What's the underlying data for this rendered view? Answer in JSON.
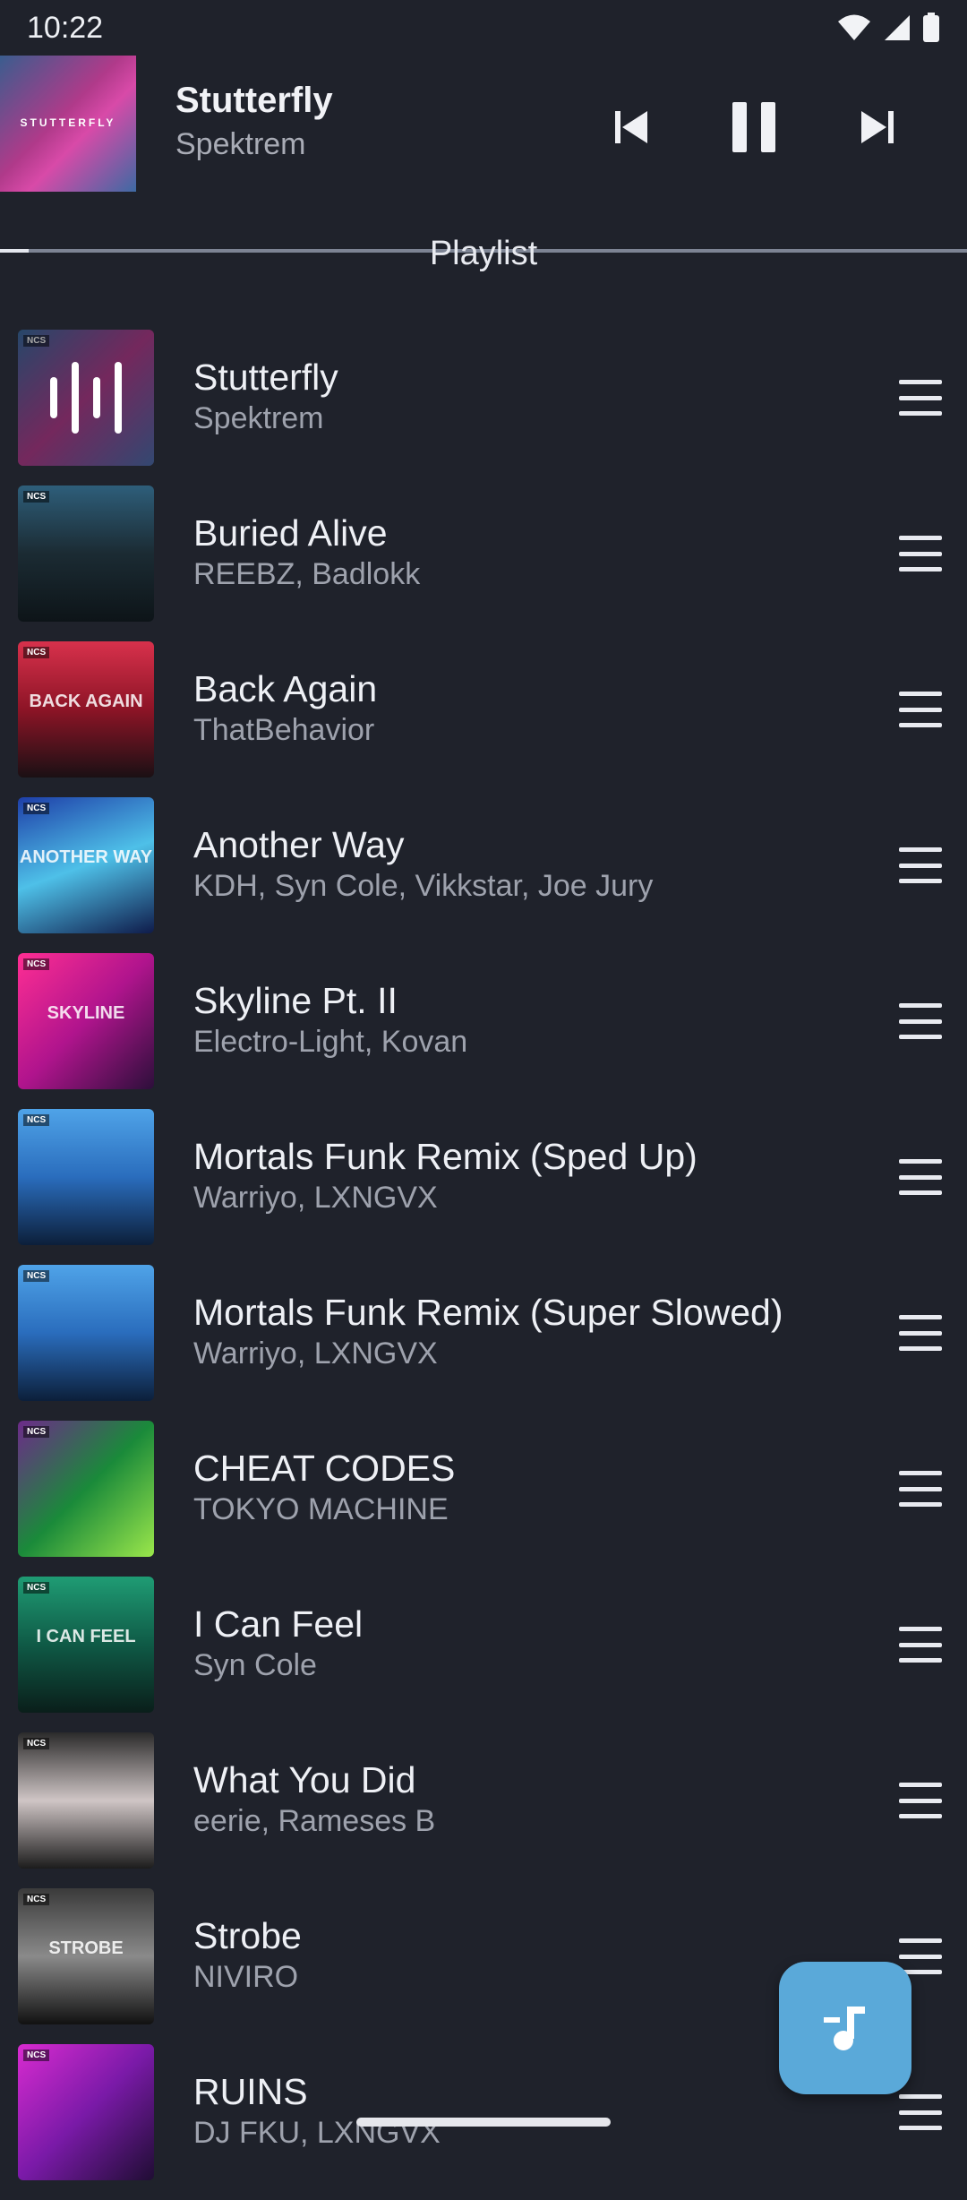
{
  "status": {
    "time": "10:22"
  },
  "now_playing": {
    "title": "Stutterfly",
    "artist": "Spektrem",
    "art_text": "STUTTERFLY",
    "progress": 0.03
  },
  "section": {
    "title": "Playlist"
  },
  "tracks": [
    {
      "title": "Stutterfly",
      "artist": "Spektrem",
      "playing": true
    },
    {
      "title": "Buried Alive",
      "artist": "REEBZ, Badlokk"
    },
    {
      "title": "Back Again",
      "artist": "ThatBehavior",
      "art_text": "BACK AGAIN"
    },
    {
      "title": "Another Way",
      "artist": "KDH, Syn Cole, Vikkstar, Joe Jury",
      "art_text": "ANOTHER WAY"
    },
    {
      "title": "Skyline Pt. II",
      "artist": "Electro-Light, Kovan",
      "art_text": "SKYLINE"
    },
    {
      "title": "Mortals Funk Remix (Sped Up)",
      "artist": "Warriyo, LXNGVX"
    },
    {
      "title": "Mortals Funk Remix (Super Slowed)",
      "artist": "Warriyo, LXNGVX"
    },
    {
      "title": "CHEAT CODES",
      "artist": "TOKYO MACHINE"
    },
    {
      "title": "I Can Feel",
      "artist": "Syn Cole",
      "art_text": "I CAN FEEL"
    },
    {
      "title": "What You Did",
      "artist": "eerie, Rameses B"
    },
    {
      "title": "Strobe",
      "artist": "NIVIRO",
      "art_text": "STROBE"
    },
    {
      "title": "RUINS",
      "artist": "DJ FKU, LXNGVX"
    }
  ],
  "art_badge": "NCS",
  "colors": {
    "background": "#1f222b",
    "fab": "#5aa9d9"
  }
}
